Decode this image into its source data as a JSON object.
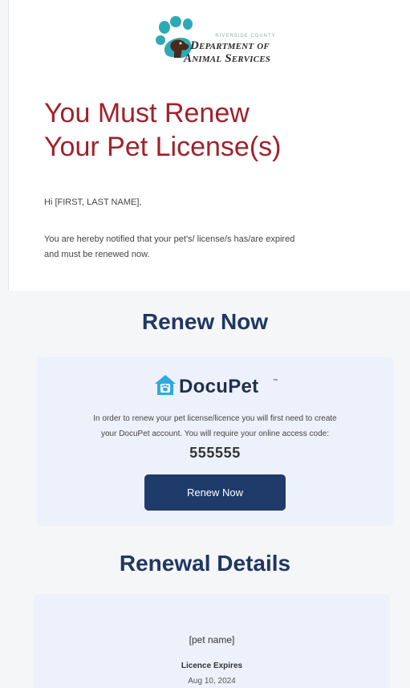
{
  "logo": {
    "county": "RIVERSIDE COUNTY",
    "line1": "Department of",
    "line2": "Animal Services",
    "icon": "paw-icon"
  },
  "header": {
    "headline_line1": "You Must Renew",
    "headline_line2": "Your Pet License(s)"
  },
  "message": {
    "greeting": "Hi [FIRST, LAST NAME],",
    "notice_line1": "You are hereby notified that your pet's/ license/s has/are expired",
    "notice_line2": "and must be renewed now."
  },
  "renew_section": {
    "title": "Renew Now",
    "brand": "DocuPet",
    "brand_tm": "™",
    "brand_icon": "house-pet-icon",
    "instructions_line1": "In order to renew your pet license/licence you will first need to create",
    "instructions_line2": "your DocuPet account. You will require your online access code:",
    "access_code": "555555",
    "button_label": "Renew Now"
  },
  "details_section": {
    "title": "Renewal Details",
    "pet_name": "[pet name]",
    "expires_label": "Licence Expires",
    "expires_date": "Aug 10, 2024"
  },
  "colors": {
    "headline": "#a0222a",
    "section_title": "#1f3763",
    "button": "#1e3b6a",
    "card_bg": "#edf1fb",
    "paw": "#2ea9b8"
  }
}
